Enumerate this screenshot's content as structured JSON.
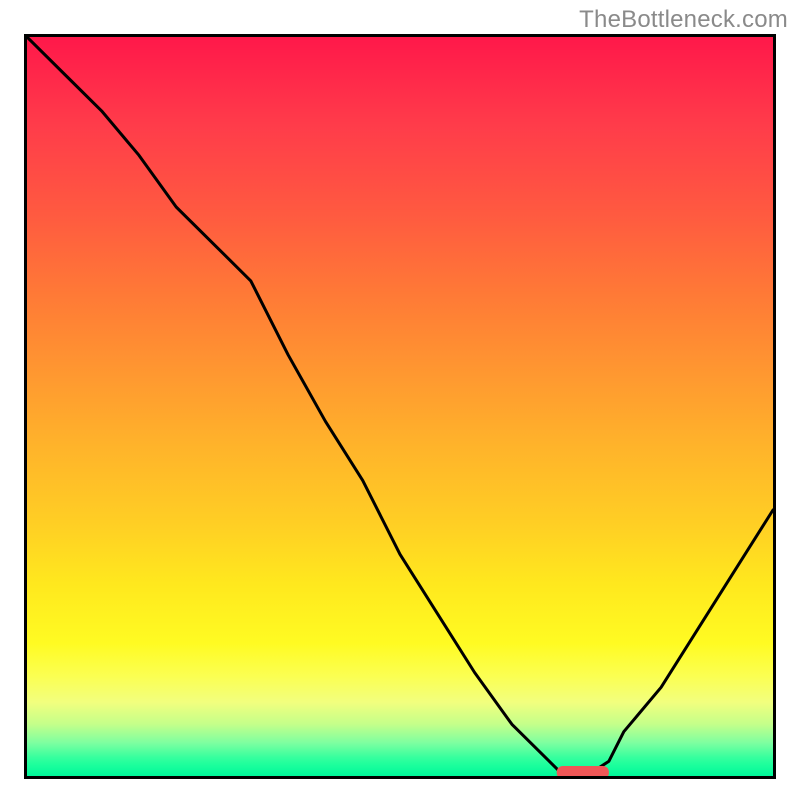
{
  "watermark": "TheBottleneck.com",
  "chart_data": {
    "type": "line",
    "title": "",
    "xlabel": "",
    "ylabel": "",
    "xlim": [
      0,
      100
    ],
    "ylim": [
      0,
      100
    ],
    "grid": false,
    "legend": false,
    "series": [
      {
        "name": "bottleneck-curve",
        "x": [
          0,
          5,
          10,
          15,
          20,
          25,
          30,
          35,
          40,
          45,
          50,
          55,
          60,
          65,
          70,
          72,
          75,
          78,
          80,
          85,
          90,
          95,
          100
        ],
        "y": [
          100,
          95,
          90,
          84,
          77,
          72,
          67,
          57,
          48,
          40,
          30,
          22,
          14,
          7,
          2,
          0,
          0,
          2,
          6,
          12,
          20,
          28,
          36
        ]
      }
    ],
    "marker": {
      "name": "sweet-spot-marker",
      "x_start": 71,
      "x_end": 78,
      "y": 0,
      "color": "#ef5757"
    },
    "gradient_stops": [
      {
        "pos": 0.0,
        "color": "#ff184a"
      },
      {
        "pos": 0.5,
        "color": "#ffb52a"
      },
      {
        "pos": 0.8,
        "color": "#fffb22"
      },
      {
        "pos": 0.95,
        "color": "#7effa0"
      },
      {
        "pos": 1.0,
        "color": "#00f79a"
      }
    ]
  }
}
